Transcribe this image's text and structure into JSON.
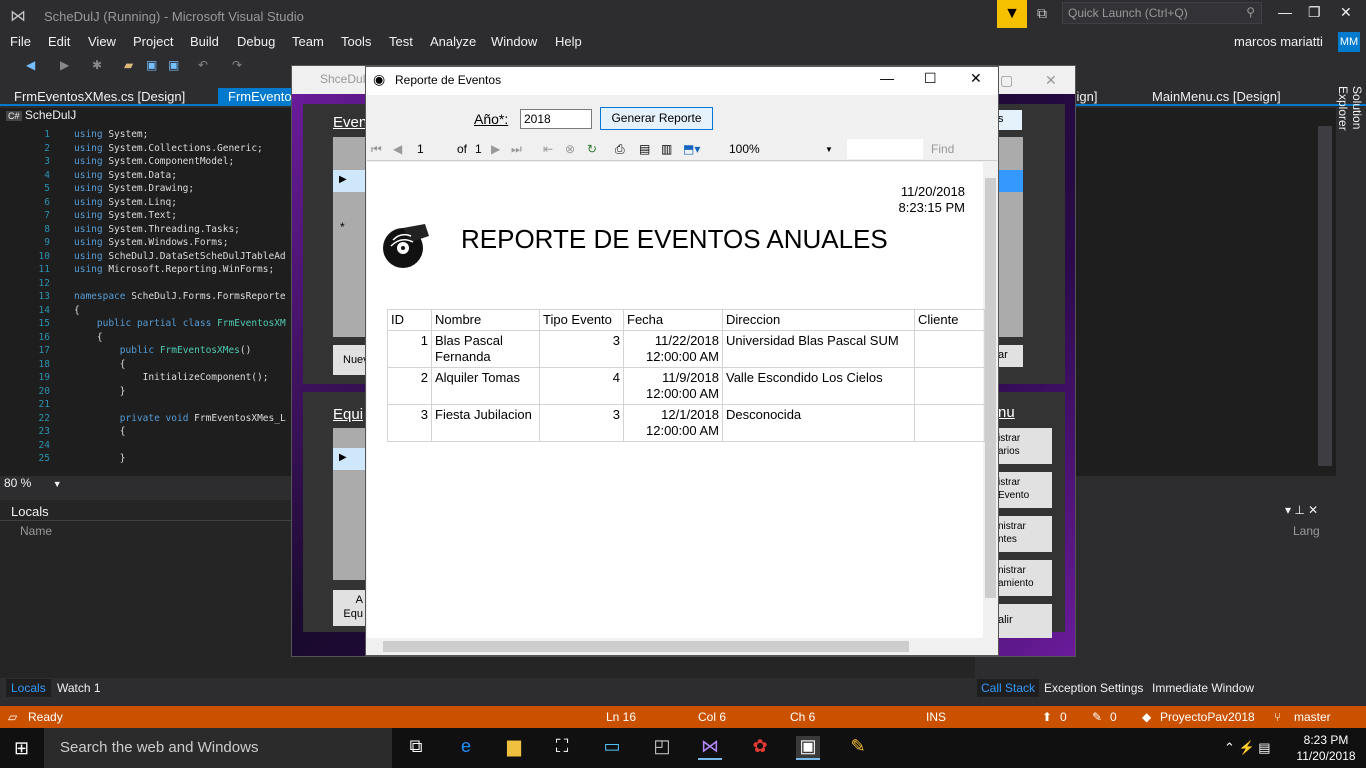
{
  "window": {
    "title": "ScheDulJ (Running) - Microsoft Visual Studio",
    "quick_launch": "Quick Launch (Ctrl+Q)",
    "user": "marcos mariatti",
    "initials": "MM"
  },
  "menu": [
    "File",
    "Edit",
    "View",
    "Project",
    "Build",
    "Debug",
    "Team",
    "Tools",
    "Test",
    "Analyze",
    "Window",
    "Help"
  ],
  "tabs": {
    "t1": "FrmEventosXMes.cs [Design]",
    "t2": "FrmEventosX",
    "t3": "sign]",
    "t4": "MainMenu.cs [Design]"
  },
  "editor": {
    "project": "ScheDulJ",
    "lines": [
      {
        "n": "1",
        "t": "using System;"
      },
      {
        "n": "2",
        "t": "using System.Collections.Generic;"
      },
      {
        "n": "3",
        "t": "using System.ComponentModel;"
      },
      {
        "n": "4",
        "t": "using System.Data;"
      },
      {
        "n": "5",
        "t": "using System.Drawing;"
      },
      {
        "n": "6",
        "t": "using System.Linq;"
      },
      {
        "n": "7",
        "t": "using System.Text;"
      },
      {
        "n": "8",
        "t": "using System.Threading.Tasks;"
      },
      {
        "n": "9",
        "t": "using System.Windows.Forms;"
      },
      {
        "n": "10",
        "t": "using ScheDulJ.DataSetScheDulJTableAd"
      },
      {
        "n": "11",
        "t": "using Microsoft.Reporting.WinForms;"
      },
      {
        "n": "12",
        "t": ""
      },
      {
        "n": "13",
        "t": "namespace ScheDulJ.Forms.FormsReporte"
      },
      {
        "n": "14",
        "t": "{"
      },
      {
        "n": "15",
        "t": "    public partial class FrmEventosXM"
      },
      {
        "n": "16",
        "t": "    {"
      },
      {
        "n": "17",
        "t": "        public FrmEventosXMes()"
      },
      {
        "n": "18",
        "t": "        {"
      },
      {
        "n": "19",
        "t": "            InitializeComponent();"
      },
      {
        "n": "20",
        "t": "        }"
      },
      {
        "n": "21",
        "t": ""
      },
      {
        "n": "22",
        "t": "        private void FrmEventosXMes_L"
      },
      {
        "n": "23",
        "t": "        {"
      },
      {
        "n": "24",
        "t": ""
      },
      {
        "n": "25",
        "t": "        }"
      }
    ],
    "zoom": "80 %"
  },
  "locals": {
    "title": "Locals",
    "col_name": "Name",
    "col_lang": "Lang"
  },
  "bottom_tabs": {
    "locals": "Locals",
    "watch": "Watch 1",
    "callstack": "Call Stack",
    "exc": "Exception Settings",
    "imm": "Immediate Window"
  },
  "status": {
    "ready": "Ready",
    "ln": "Ln 16",
    "col": "Col 6",
    "ch": "Ch 6",
    "ins": "INS",
    "up": "0",
    "pen": "0",
    "project": "ProyectoPav2018",
    "branch": "master"
  },
  "taskbar": {
    "search": "Search the web and Windows",
    "time": "8:23 PM",
    "date": "11/20/2018"
  },
  "bg_form": {
    "title": "ShceDulJ",
    "events_label": "Even",
    "new_btn": "Nuev",
    "equip_label": "Equi",
    "eq_btn_a": "A",
    "eq_btn_b": "Equ",
    "right_btn": "s",
    "right_btn2": "ar",
    "menu_label": "nu",
    "admin1a": "istrar",
    "admin1b": "arios",
    "admin2a": "istrar",
    "admin2b": "Evento",
    "admin3a": "nistrar",
    "admin3b": "ntes",
    "admin4a": "nistrar",
    "admin4b": "amiento",
    "salir": "alir"
  },
  "dialog": {
    "title": "Reporte de Eventos",
    "anio_label": "Año*:",
    "anio_value": "2018",
    "gen_button": "Generar Reporte",
    "toolbar": {
      "page": "1",
      "of": "of",
      "total": "1",
      "zoom": "100%",
      "find": "Find"
    },
    "report": {
      "date": "11/20/2018",
      "time": "8:23:15 PM",
      "title": "REPORTE DE EVENTOS ANUALES",
      "headers": [
        "ID",
        "Nombre",
        "Tipo Evento",
        "Fecha",
        "Direccion",
        "Cliente"
      ],
      "rows": [
        {
          "id": "1",
          "nombre": "Blas Pascal Fernanda",
          "tipo": "3",
          "fecha": "11/22/2018",
          "hora": "12:00:00 AM",
          "dir": "Universidad Blas Pascal SUM",
          "cliente": ""
        },
        {
          "id": "2",
          "nombre": "Alquiler Tomas",
          "tipo": "4",
          "fecha": "11/9/2018",
          "hora": "12:00:00 AM",
          "dir": "Valle Escondido Los Cielos",
          "cliente": ""
        },
        {
          "id": "3",
          "nombre": "Fiesta Jubilacion",
          "tipo": "3",
          "fecha": "12/1/2018",
          "hora": "12:00:00 AM",
          "dir": "Desconocida",
          "cliente": ""
        }
      ]
    }
  }
}
